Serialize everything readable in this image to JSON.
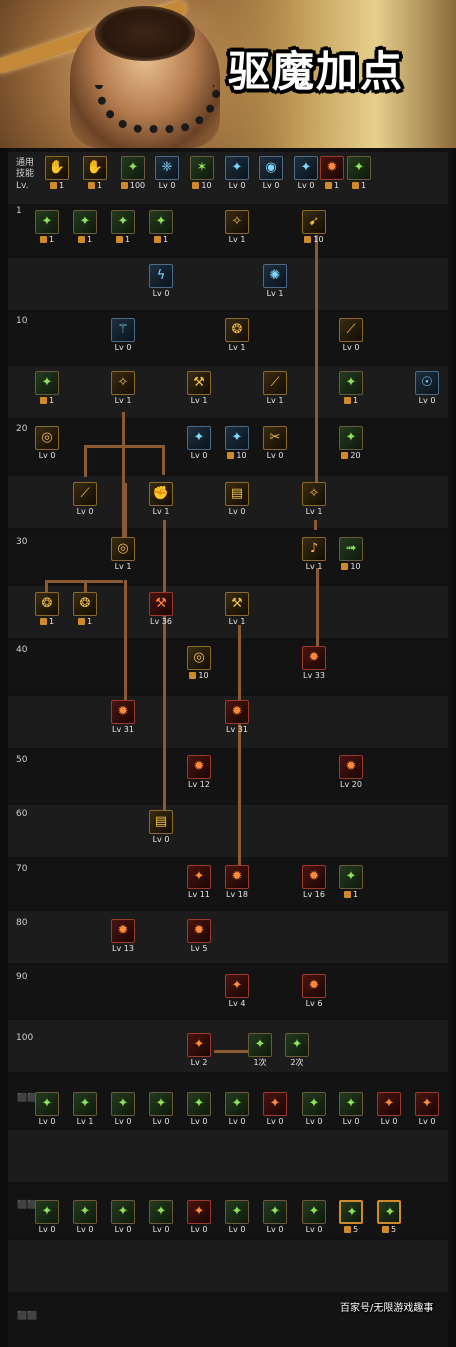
{
  "banner": {
    "title": "驱魔加点"
  },
  "general_label": "通用\n技能",
  "lv_abbr": "Lv.",
  "levels": [
    "1",
    "10",
    "20",
    "30",
    "40",
    "50",
    "60",
    "70",
    "80",
    "90",
    "100"
  ],
  "second_row_markers": [
    "⬛⬛",
    "⬛⬛",
    "⬛⬛"
  ],
  "watermark": "百家号/无限游戏趣事",
  "skills": [
    {
      "label": "1",
      "style": "gold",
      "icon": "hand-icon"
    },
    {
      "label": "1",
      "style": "gold",
      "icon": "hand-icon"
    },
    {
      "label": "100",
      "style": "green",
      "icon": "figure-icon"
    },
    {
      "label": "Lv 0",
      "style": "blue",
      "icon": "wings-icon"
    },
    {
      "label": "10",
      "style": "green",
      "icon": "star-icon"
    },
    {
      "label": "Lv 0",
      "style": "blue",
      "icon": "figure-icon"
    },
    {
      "label": "Lv 0",
      "style": "blue",
      "icon": "eye-icon"
    },
    {
      "label": "Lv 0",
      "style": "blue",
      "icon": "figure-icon"
    },
    {
      "label": "1",
      "style": "red",
      "icon": "flame-icon"
    },
    {
      "label": "1",
      "style": "green",
      "icon": "figure-icon"
    },
    {
      "label": "1",
      "style": "green",
      "icon": "figure-icon"
    },
    {
      "label": "1",
      "style": "green",
      "icon": "figure-icon"
    },
    {
      "label": "1",
      "style": "green",
      "icon": "figure-icon"
    },
    {
      "label": "1",
      "style": "green",
      "icon": "figure-icon"
    },
    {
      "label": "Lv 1",
      "style": "gold",
      "icon": "spark-icon"
    },
    {
      "label": "10",
      "style": "gold",
      "icon": "strike-icon"
    },
    {
      "label": "Lv 0",
      "style": "blue",
      "icon": "bolt-icon"
    },
    {
      "label": "Lv 1",
      "style": "blue",
      "icon": "swirl-icon"
    },
    {
      "label": "Lv 0",
      "style": "blue",
      "icon": "staff-icon"
    },
    {
      "label": "Lv 1",
      "style": "gold",
      "icon": "shield-icon"
    },
    {
      "label": "Lv 0",
      "style": "gold",
      "icon": "slash-icon"
    },
    {
      "label": "1",
      "style": "green",
      "icon": "figure-icon"
    },
    {
      "label": "Lv 1",
      "style": "gold",
      "icon": "spark-icon"
    },
    {
      "label": "Lv 1",
      "style": "gold",
      "icon": "hammer-icon"
    },
    {
      "label": "Lv 1",
      "style": "gold",
      "icon": "slash-icon"
    },
    {
      "label": "1",
      "style": "green",
      "icon": "figure-icon"
    },
    {
      "label": "Lv 0",
      "style": "blue",
      "icon": "mask-icon"
    },
    {
      "label": "Lv 0",
      "style": "gold",
      "icon": "ring-icon"
    },
    {
      "label": "Lv 0",
      "style": "blue",
      "icon": "figure-icon"
    },
    {
      "label": "10",
      "style": "blue",
      "icon": "figure-icon"
    },
    {
      "label": "Lv 0",
      "style": "gold",
      "icon": "claw-icon"
    },
    {
      "label": "20",
      "style": "green",
      "icon": "figure-icon"
    },
    {
      "label": "Lv 0",
      "style": "gold",
      "icon": "slash-icon"
    },
    {
      "label": "Lv 1",
      "style": "gold",
      "icon": "fist-icon"
    },
    {
      "label": "Lv 0",
      "style": "gold",
      "icon": "book-icon"
    },
    {
      "label": "Lv 1",
      "style": "gold",
      "icon": "spark-icon"
    },
    {
      "label": "Lv 1",
      "style": "gold",
      "icon": "ring-icon"
    },
    {
      "label": "Lv 1",
      "style": "gold",
      "icon": "note-icon"
    },
    {
      "label": "10",
      "style": "green",
      "icon": "dash-icon"
    },
    {
      "label": "1",
      "style": "gold",
      "icon": "shield-icon"
    },
    {
      "label": "1",
      "style": "gold",
      "icon": "shield-icon"
    },
    {
      "label": "Lv 36",
      "style": "red",
      "icon": "hammer-icon"
    },
    {
      "label": "Lv 1",
      "style": "gold",
      "icon": "hammer-icon"
    },
    {
      "label": "10",
      "style": "gold",
      "icon": "ring-icon"
    },
    {
      "label": "Lv 33",
      "style": "red",
      "icon": "flame-icon"
    },
    {
      "label": "Lv 31",
      "style": "red",
      "icon": "flame-icon"
    },
    {
      "label": "Lv 31",
      "style": "red",
      "icon": "flame-icon"
    },
    {
      "label": "Lv 12",
      "style": "red",
      "icon": "flame-icon"
    },
    {
      "label": "Lv 20",
      "style": "red",
      "icon": "flame-icon"
    },
    {
      "label": "Lv 0",
      "style": "gold",
      "icon": "book-icon"
    },
    {
      "label": "Lv 11",
      "style": "red",
      "icon": "figure-icon"
    },
    {
      "label": "Lv 18",
      "style": "red",
      "icon": "flame-icon"
    },
    {
      "label": "Lv 16",
      "style": "red",
      "icon": "flame-icon"
    },
    {
      "label": "1",
      "style": "green",
      "icon": "figure-icon"
    },
    {
      "label": "Lv 13",
      "style": "red",
      "icon": "flame-icon"
    },
    {
      "label": "Lv 5",
      "style": "red",
      "icon": "flame-icon"
    },
    {
      "label": "Lv 4",
      "style": "red",
      "icon": "figure-icon"
    },
    {
      "label": "Lv 6",
      "style": "red",
      "icon": "flame-icon"
    },
    {
      "label": "Lv 2",
      "style": "red",
      "icon": "figure-icon"
    },
    {
      "label": "1次",
      "style": "green",
      "icon": "figure-icon"
    },
    {
      "label": "2次",
      "style": "green",
      "icon": "figure-icon"
    },
    {
      "label": "Lv 0",
      "style": "green",
      "icon": "figure-icon"
    },
    {
      "label": "Lv 1",
      "style": "green",
      "icon": "figure-icon"
    },
    {
      "label": "Lv 0",
      "style": "green",
      "icon": "figure-icon"
    },
    {
      "label": "Lv 0",
      "style": "green",
      "icon": "figure-icon"
    },
    {
      "label": "Lv 0",
      "style": "green",
      "icon": "figure-icon"
    },
    {
      "label": "Lv 0",
      "style": "green",
      "icon": "figure-icon"
    },
    {
      "label": "Lv 0",
      "style": "red",
      "icon": "figure-icon"
    },
    {
      "label": "Lv 0",
      "style": "green",
      "icon": "figure-icon"
    },
    {
      "label": "Lv 0",
      "style": "green",
      "icon": "figure-icon"
    },
    {
      "label": "Lv 0",
      "style": "red",
      "icon": "figure-icon"
    },
    {
      "label": "Lv 0",
      "style": "red",
      "icon": "figure-icon"
    },
    {
      "label": "Lv 0",
      "style": "green",
      "icon": "figure-icon"
    },
    {
      "label": "Lv 0",
      "style": "green",
      "icon": "figure-icon"
    },
    {
      "label": "Lv 0",
      "style": "green",
      "icon": "figure-icon"
    },
    {
      "label": "Lv 0",
      "style": "green",
      "icon": "figure-icon"
    },
    {
      "label": "Lv 0",
      "style": "red",
      "icon": "figure-icon"
    },
    {
      "label": "Lv 0",
      "style": "green",
      "icon": "figure-icon"
    },
    {
      "label": "Lv 0",
      "style": "green",
      "icon": "figure-icon"
    },
    {
      "label": "Lv 0",
      "style": "green",
      "icon": "figure-icon"
    },
    {
      "label": "5",
      "style": "green",
      "icon": "figure-icon"
    },
    {
      "label": "5",
      "style": "green",
      "icon": "figure-icon"
    }
  ]
}
